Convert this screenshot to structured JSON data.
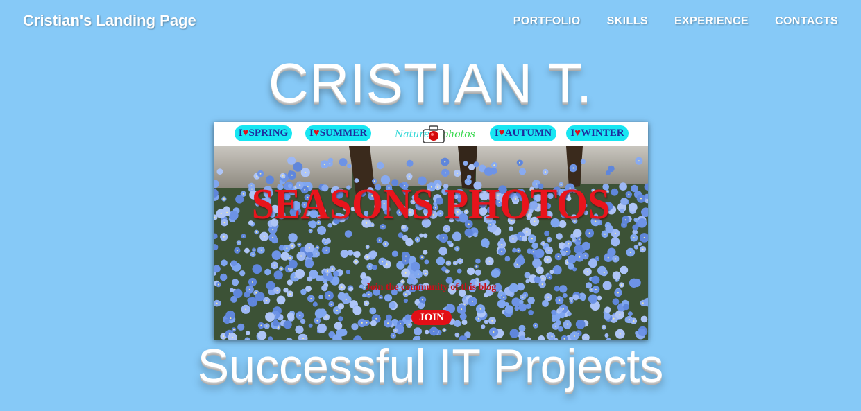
{
  "navbar": {
    "brand": "Cristian's Landing Page",
    "links": [
      "PORTFOLIO",
      "SKILLS",
      "EXPERIENCE",
      "CONTACTS"
    ]
  },
  "hero": {
    "title": "CRISTIAN T.",
    "subtitle": "Successful IT Projects"
  },
  "project_preview": {
    "season_tabs": [
      {
        "prefix": "I",
        "heart": "♥",
        "label": "SPRING"
      },
      {
        "prefix": "I",
        "heart": "♥",
        "label": "SUMMER"
      },
      {
        "prefix": "I",
        "heart": "♥",
        "label": "AUTUMN"
      },
      {
        "prefix": "I",
        "heart": "♥",
        "label": "WINTER"
      }
    ],
    "logo": {
      "part1": "Nature",
      "part2": "photos",
      "icon": "camera-icon"
    },
    "banner_title": "SEASONS PHOTOS",
    "tagline": "Join the community of this blog",
    "join_label": "JOIN",
    "photo_subject": "forget-me-not-flowers-photo"
  },
  "colors": {
    "page_background": "#86c9f7",
    "pill_background": "#17e6f2",
    "pill_text": "#1f2a9c",
    "heart": "#e0111a",
    "banner_red": "#e8141c",
    "flower_blue": "#7aa2ee"
  }
}
